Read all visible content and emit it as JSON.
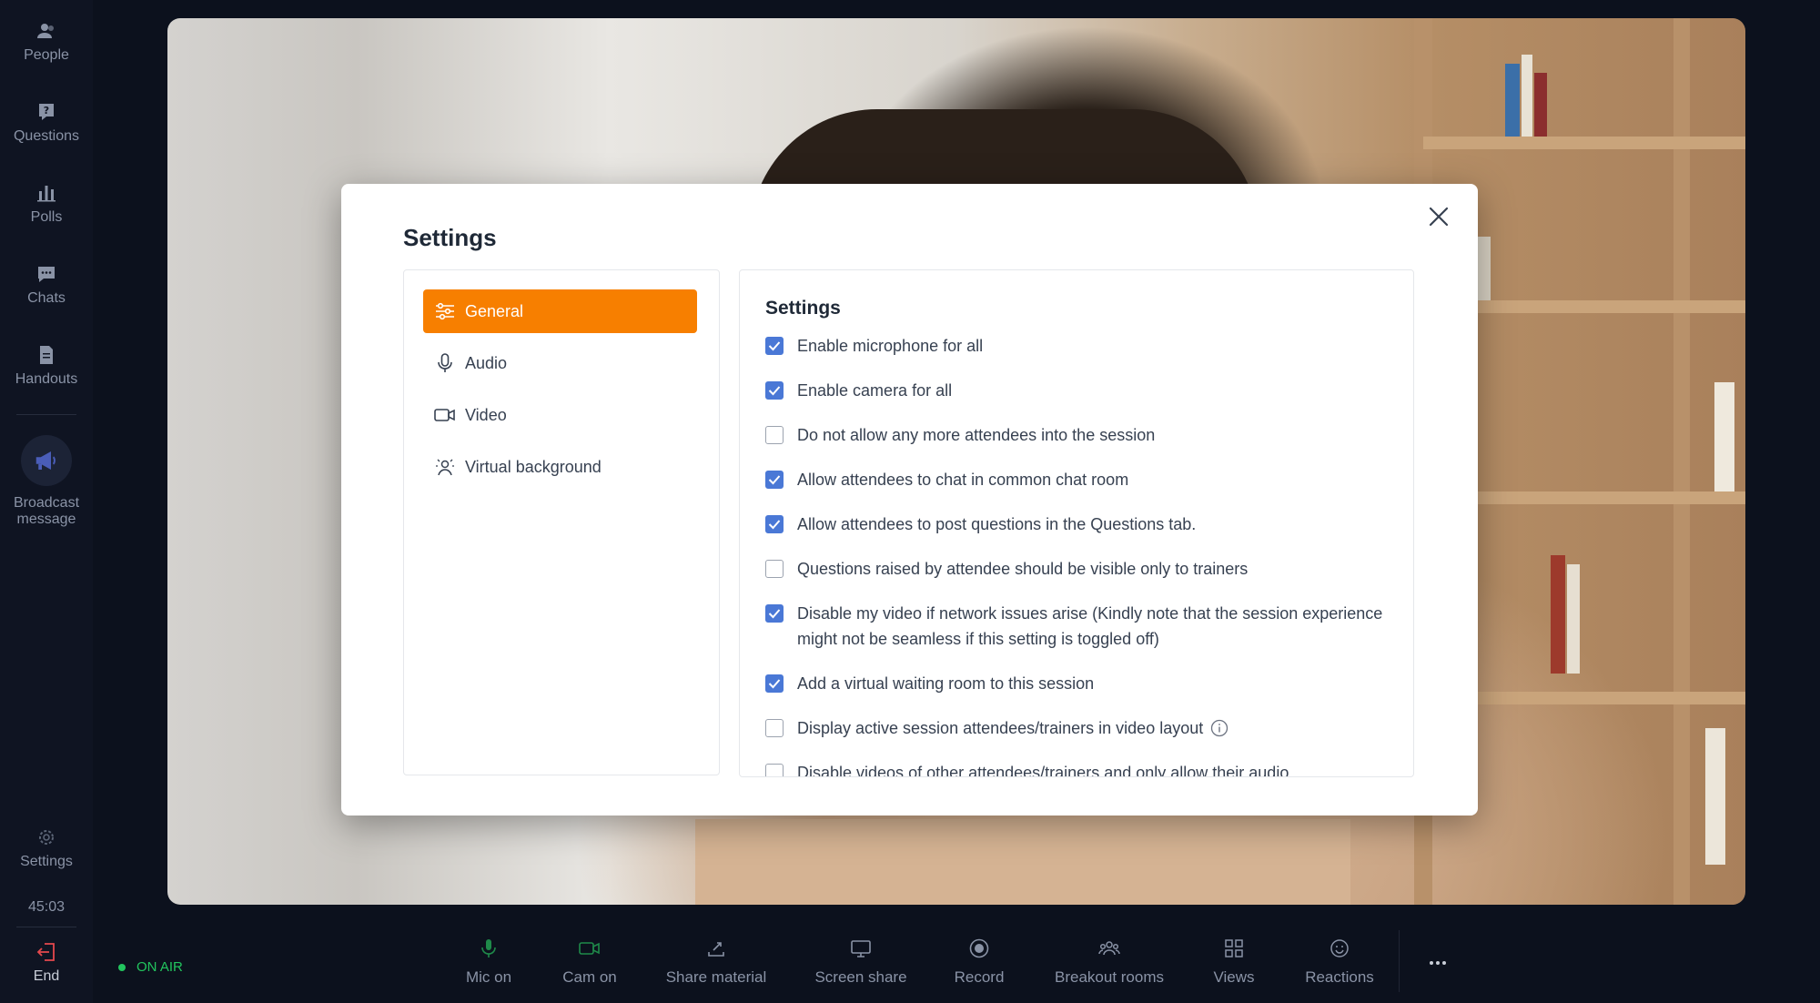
{
  "sidebar": {
    "items": [
      {
        "label": "People",
        "icon": "people-icon"
      },
      {
        "label": "Questions",
        "icon": "question-icon"
      },
      {
        "label": "Polls",
        "icon": "polls-icon"
      },
      {
        "label": "Chats",
        "icon": "chat-icon"
      },
      {
        "label": "Handouts",
        "icon": "handouts-icon"
      }
    ],
    "broadcast_label_1": "Broadcast",
    "broadcast_label_2": "message",
    "settings_label": "Settings",
    "timer": "45:03",
    "end_label": "End"
  },
  "modal": {
    "title": "Settings",
    "close_icon": "close-icon",
    "nav": [
      {
        "label": "General",
        "active": true
      },
      {
        "label": "Audio",
        "active": false
      },
      {
        "label": "Video",
        "active": false
      },
      {
        "label": "Virtual background",
        "active": false
      }
    ],
    "panel_title": "Settings",
    "options": [
      {
        "label": "Enable microphone for all",
        "checked": true
      },
      {
        "label": "Enable camera for all",
        "checked": true
      },
      {
        "label": "Do not allow any more attendees into the session",
        "checked": false
      },
      {
        "label": "Allow attendees to chat in common chat room",
        "checked": true
      },
      {
        "label": "Allow attendees to post questions in the Questions tab.",
        "checked": true
      },
      {
        "label": "Questions raised by attendee should be visible only to trainers",
        "checked": false
      },
      {
        "label": "Disable my video if network issues arise (Kindly note that the session experience might not be seamless if this setting is toggled off)",
        "checked": true
      },
      {
        "label": "Add a virtual waiting room to this session",
        "checked": true
      },
      {
        "label": "Display active session attendees/trainers in video layout",
        "checked": false
      },
      {
        "label": "Disable videos of other attendees/trainers and only allow their audio",
        "checked": false
      }
    ]
  },
  "bottombar": {
    "status": "ON AIR",
    "status_color": "#22c55e",
    "tools": [
      {
        "label": "Mic on",
        "icon": "mic-icon",
        "color": "#22c55e"
      },
      {
        "label": "Cam on",
        "icon": "camera-icon",
        "color": "#22c55e"
      },
      {
        "label": "Share material",
        "icon": "share-material-icon",
        "color": "#8a93a6"
      },
      {
        "label": "Screen share",
        "icon": "screen-share-icon",
        "color": "#8a93a6"
      },
      {
        "label": "Record",
        "icon": "record-icon",
        "color": "#8a93a6"
      },
      {
        "label": "Breakout rooms",
        "icon": "breakout-rooms-icon",
        "color": "#8a93a6"
      },
      {
        "label": "Views",
        "icon": "views-icon",
        "color": "#8a93a6"
      },
      {
        "label": "Reactions",
        "icon": "reactions-icon",
        "color": "#8a93a6"
      }
    ],
    "more_icon": "more-icon"
  },
  "accent_color": "#f77f00",
  "checkbox_color": "#4a78d6"
}
